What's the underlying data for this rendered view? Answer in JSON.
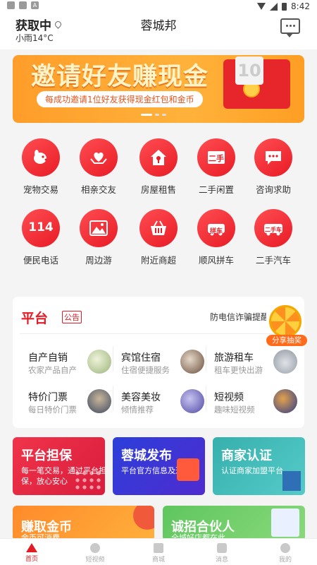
{
  "status_bar": {
    "time": "8:42",
    "left_icons": [
      "▪",
      "▪",
      "A"
    ]
  },
  "header": {
    "location": "获取中",
    "weather": "小雨14°C",
    "title": "蓉城邦"
  },
  "banner": {
    "title": "邀请好友赚现金",
    "subtitle": "每成功邀请1位好友获得现金红包和金币",
    "card_text": "10"
  },
  "services": [
    {
      "label": "宠物交易",
      "icon": "dog-icon"
    },
    {
      "label": "相亲交友",
      "icon": "heart-hands-icon"
    },
    {
      "label": "房屋租售",
      "icon": "house-key-icon"
    },
    {
      "label": "二手闲置",
      "icon": "secondhand-icon",
      "text": "二手"
    },
    {
      "label": "咨询求助",
      "icon": "chat-bubble-icon"
    },
    {
      "label": "便民电话",
      "icon": "phone-114-icon",
      "text": "114"
    },
    {
      "label": "周边游",
      "icon": "mountain-icon"
    },
    {
      "label": "附近商超",
      "icon": "basket-icon"
    },
    {
      "label": "顺风拼车",
      "icon": "carpool-icon",
      "text": "拼车"
    },
    {
      "label": "二手汽车",
      "icon": "used-car-icon",
      "text": "二手车"
    }
  ],
  "platform": {
    "title": "平台",
    "notice_tag": "公告",
    "notice_text": "防电信诈骗提醒,平",
    "lottery_label": "分享抽奖",
    "items": [
      {
        "title": "自产自销",
        "desc": "农家产品自产",
        "color": "#c9d6a8"
      },
      {
        "title": "宾馆住宿",
        "desc": "住宿便捷服务",
        "color": "#8a6a56"
      },
      {
        "title": "旅游租车",
        "desc": "租车更快出游",
        "color": "#b9bec7"
      },
      {
        "title": "特价门票",
        "desc": "每日特价门票",
        "color": "#4c5a78"
      },
      {
        "title": "美容美妆",
        "desc": "倾情推荐",
        "color": "#6b5fb5"
      },
      {
        "title": "短视频",
        "desc": "趣味短视频",
        "color": "#3d4fa0"
      }
    ]
  },
  "promos": [
    {
      "title": "平台担保",
      "desc": "每一笔交易，通过平台担保，放心安心"
    },
    {
      "title": "蓉城发布",
      "desc": "平台官方信息及通知"
    },
    {
      "title": "商家认证",
      "desc": "认证商家加盟平台"
    },
    {
      "title": "赚取金币",
      "desc": "金币可消费"
    },
    {
      "title": "诚招合伙人",
      "desc": "全城好店都在此"
    }
  ],
  "tabs": [
    {
      "label": "首页",
      "active": true
    },
    {
      "label": "短视频"
    },
    {
      "label": "商城"
    },
    {
      "label": "消息"
    },
    {
      "label": "我的"
    }
  ],
  "colors": {
    "brand_red": "#e21b24"
  }
}
